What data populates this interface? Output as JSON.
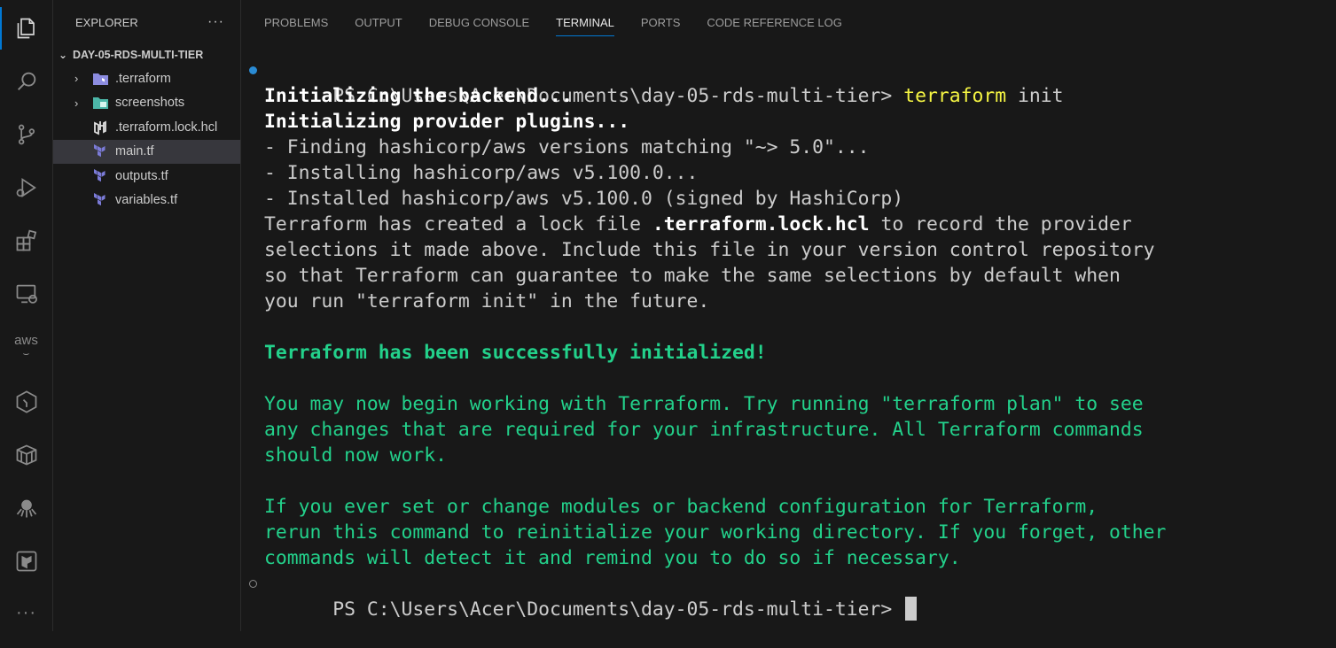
{
  "activity_bar": {
    "items": [
      "explorer-icon",
      "search-icon",
      "source-control-icon",
      "run-debug-icon",
      "extensions-icon",
      "remote-explorer-icon",
      "aws-icon",
      "hexagon-icon",
      "container-icon",
      "octopus-icon",
      "terraform-icon"
    ],
    "aws_label": "aws",
    "more": "···"
  },
  "sidebar": {
    "title": "EXPLORER",
    "more": "···",
    "folder": "DAY-05-RDS-MULTI-TIER",
    "items": [
      {
        "label": ".terraform",
        "type": "folder"
      },
      {
        "label": "screenshots",
        "type": "folder"
      },
      {
        "label": ".terraform.lock.hcl",
        "type": "file"
      },
      {
        "label": "main.tf",
        "type": "file",
        "selected": true
      },
      {
        "label": "outputs.tf",
        "type": "file"
      },
      {
        "label": "variables.tf",
        "type": "file"
      }
    ]
  },
  "panel": {
    "tabs": [
      "PROBLEMS",
      "OUTPUT",
      "DEBUG CONSOLE",
      "TERMINAL",
      "PORTS",
      "CODE REFERENCE LOG"
    ],
    "active_tab": "TERMINAL"
  },
  "terminal": {
    "prompt": "PS C:\\Users\\Acer\\Documents\\day-05-rds-multi-tier> ",
    "command_name": "terraform",
    "command_args": " init",
    "l1": "Initializing the backend...",
    "l2": "Initializing provider plugins...",
    "l3": "- Finding hashicorp/aws versions matching \"~> 5.0\"...",
    "l4": "- Installing hashicorp/aws v5.100.0...",
    "l5": "- Installed hashicorp/aws v5.100.0 (signed by HashiCorp)",
    "l6a": "Terraform has created a lock file ",
    "l6b": ".terraform.lock.hcl",
    "l6c": " to record the provider",
    "l7": "selections it made above. Include this file in your version control repository",
    "l8": "so that Terraform can guarantee to make the same selections by default when",
    "l9": "you run \"terraform init\" in the future.",
    "success": "Terraform has been successfully initialized!",
    "g1": "You may now begin working with Terraform. Try running \"terraform plan\" to see",
    "g2": "any changes that are required for your infrastructure. All Terraform commands",
    "g3": "should now work.",
    "g4": "If you ever set or change modules or backend configuration for Terraform,",
    "g5": "rerun this command to reinitialize your working directory. If you forget, other",
    "g6": "commands will detect it and remind you to do so if necessary.",
    "final_prompt": "PS C:\\Users\\Acer\\Documents\\day-05-rds-multi-tier> "
  },
  "colors": {
    "accent": "#0078d4",
    "success_green": "#23d18b",
    "command_yellow": "#f5f543"
  }
}
